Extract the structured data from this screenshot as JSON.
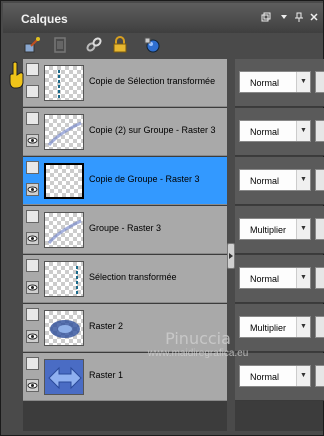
{
  "panel": {
    "title": "Calques"
  },
  "title_controls": [
    "restore-icon",
    "dropdown-icon",
    "pin-icon",
    "close-icon"
  ],
  "toolbar": {
    "icons": [
      "paint-brush-icon",
      "new-layer-icon",
      "link-icon",
      "lock-icon",
      "globe-mask-icon"
    ]
  },
  "layers": [
    {
      "name": "Copie de Sélection transformée",
      "blend": "Normal",
      "selected": false
    },
    {
      "name": "Copie (2) sur Groupe - Raster 3",
      "blend": "Normal",
      "selected": false
    },
    {
      "name": "Copie de Groupe - Raster 3",
      "blend": "Normal",
      "selected": true
    },
    {
      "name": "Groupe - Raster 3",
      "blend": "Multiplier",
      "selected": false
    },
    {
      "name": "Sélection transformée",
      "blend": "Normal",
      "selected": false
    },
    {
      "name": "Raster 2",
      "blend": "Multiplier",
      "selected": false
    },
    {
      "name": "Raster 1",
      "blend": "Normal",
      "selected": false
    }
  ],
  "watermark": {
    "name": "Pinuccia",
    "url": "www.maidiregrafica.eu"
  },
  "colors": {
    "selected": "#3399ff",
    "row": "#a9a9a9",
    "panel": "#4a4a4a"
  }
}
